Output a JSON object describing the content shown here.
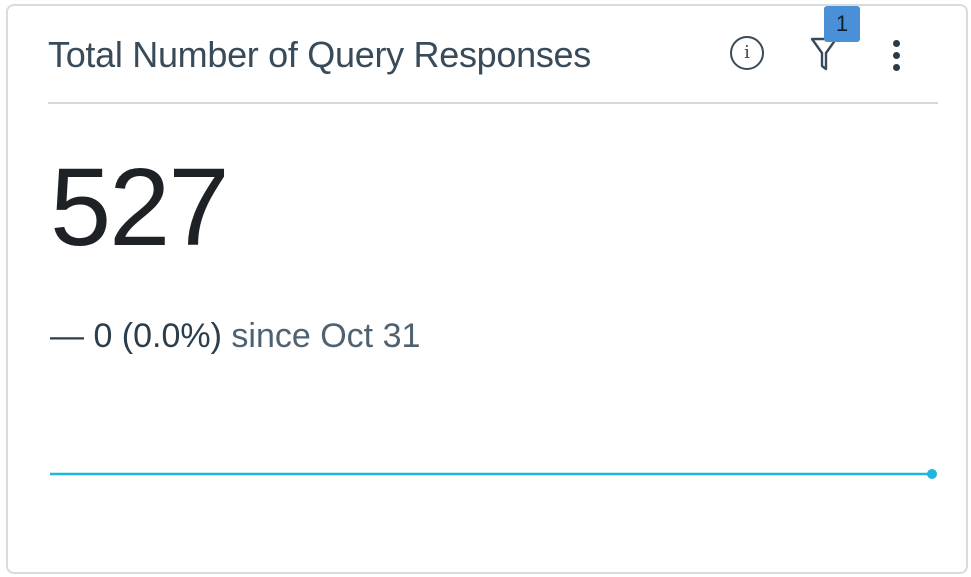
{
  "card": {
    "title": "Total Number of Query Responses",
    "value": "527",
    "change": {
      "dash": "—",
      "amount": "0 (0.0%)",
      "since": "since Oct 31"
    },
    "filter_count": "1",
    "info_icon": "info-icon",
    "filter_icon": "filter-icon",
    "menu_icon": "more-vertical-icon",
    "sparkline_color": "#1fb6e0",
    "badge_color": "#4a90d6",
    "sparkline_trend": "flat"
  }
}
